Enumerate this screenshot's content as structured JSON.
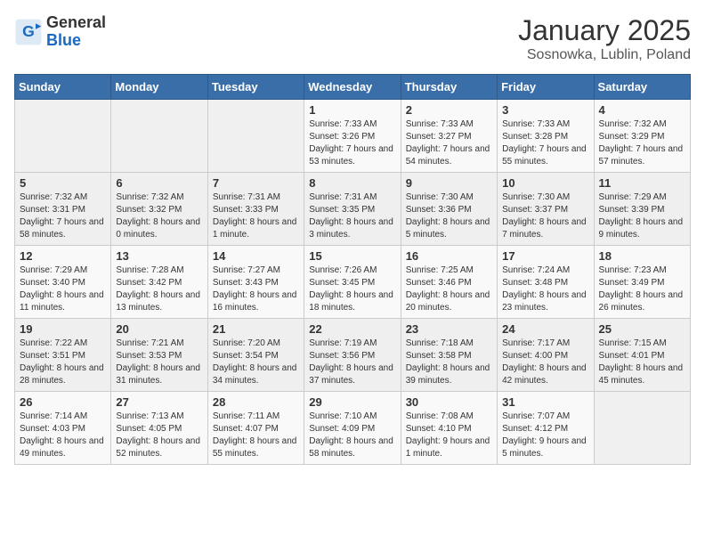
{
  "header": {
    "logo_general": "General",
    "logo_blue": "Blue",
    "title": "January 2025",
    "subtitle": "Sosnowka, Lublin, Poland"
  },
  "calendar": {
    "days_of_week": [
      "Sunday",
      "Monday",
      "Tuesday",
      "Wednesday",
      "Thursday",
      "Friday",
      "Saturday"
    ],
    "weeks": [
      [
        {
          "day": "",
          "info": ""
        },
        {
          "day": "",
          "info": ""
        },
        {
          "day": "",
          "info": ""
        },
        {
          "day": "1",
          "info": "Sunrise: 7:33 AM\nSunset: 3:26 PM\nDaylight: 7 hours and 53 minutes."
        },
        {
          "day": "2",
          "info": "Sunrise: 7:33 AM\nSunset: 3:27 PM\nDaylight: 7 hours and 54 minutes."
        },
        {
          "day": "3",
          "info": "Sunrise: 7:33 AM\nSunset: 3:28 PM\nDaylight: 7 hours and 55 minutes."
        },
        {
          "day": "4",
          "info": "Sunrise: 7:32 AM\nSunset: 3:29 PM\nDaylight: 7 hours and 57 minutes."
        }
      ],
      [
        {
          "day": "5",
          "info": "Sunrise: 7:32 AM\nSunset: 3:31 PM\nDaylight: 7 hours and 58 minutes."
        },
        {
          "day": "6",
          "info": "Sunrise: 7:32 AM\nSunset: 3:32 PM\nDaylight: 8 hours and 0 minutes."
        },
        {
          "day": "7",
          "info": "Sunrise: 7:31 AM\nSunset: 3:33 PM\nDaylight: 8 hours and 1 minute."
        },
        {
          "day": "8",
          "info": "Sunrise: 7:31 AM\nSunset: 3:35 PM\nDaylight: 8 hours and 3 minutes."
        },
        {
          "day": "9",
          "info": "Sunrise: 7:30 AM\nSunset: 3:36 PM\nDaylight: 8 hours and 5 minutes."
        },
        {
          "day": "10",
          "info": "Sunrise: 7:30 AM\nSunset: 3:37 PM\nDaylight: 8 hours and 7 minutes."
        },
        {
          "day": "11",
          "info": "Sunrise: 7:29 AM\nSunset: 3:39 PM\nDaylight: 8 hours and 9 minutes."
        }
      ],
      [
        {
          "day": "12",
          "info": "Sunrise: 7:29 AM\nSunset: 3:40 PM\nDaylight: 8 hours and 11 minutes."
        },
        {
          "day": "13",
          "info": "Sunrise: 7:28 AM\nSunset: 3:42 PM\nDaylight: 8 hours and 13 minutes."
        },
        {
          "day": "14",
          "info": "Sunrise: 7:27 AM\nSunset: 3:43 PM\nDaylight: 8 hours and 16 minutes."
        },
        {
          "day": "15",
          "info": "Sunrise: 7:26 AM\nSunset: 3:45 PM\nDaylight: 8 hours and 18 minutes."
        },
        {
          "day": "16",
          "info": "Sunrise: 7:25 AM\nSunset: 3:46 PM\nDaylight: 8 hours and 20 minutes."
        },
        {
          "day": "17",
          "info": "Sunrise: 7:24 AM\nSunset: 3:48 PM\nDaylight: 8 hours and 23 minutes."
        },
        {
          "day": "18",
          "info": "Sunrise: 7:23 AM\nSunset: 3:49 PM\nDaylight: 8 hours and 26 minutes."
        }
      ],
      [
        {
          "day": "19",
          "info": "Sunrise: 7:22 AM\nSunset: 3:51 PM\nDaylight: 8 hours and 28 minutes."
        },
        {
          "day": "20",
          "info": "Sunrise: 7:21 AM\nSunset: 3:53 PM\nDaylight: 8 hours and 31 minutes."
        },
        {
          "day": "21",
          "info": "Sunrise: 7:20 AM\nSunset: 3:54 PM\nDaylight: 8 hours and 34 minutes."
        },
        {
          "day": "22",
          "info": "Sunrise: 7:19 AM\nSunset: 3:56 PM\nDaylight: 8 hours and 37 minutes."
        },
        {
          "day": "23",
          "info": "Sunrise: 7:18 AM\nSunset: 3:58 PM\nDaylight: 8 hours and 39 minutes."
        },
        {
          "day": "24",
          "info": "Sunrise: 7:17 AM\nSunset: 4:00 PM\nDaylight: 8 hours and 42 minutes."
        },
        {
          "day": "25",
          "info": "Sunrise: 7:15 AM\nSunset: 4:01 PM\nDaylight: 8 hours and 45 minutes."
        }
      ],
      [
        {
          "day": "26",
          "info": "Sunrise: 7:14 AM\nSunset: 4:03 PM\nDaylight: 8 hours and 49 minutes."
        },
        {
          "day": "27",
          "info": "Sunrise: 7:13 AM\nSunset: 4:05 PM\nDaylight: 8 hours and 52 minutes."
        },
        {
          "day": "28",
          "info": "Sunrise: 7:11 AM\nSunset: 4:07 PM\nDaylight: 8 hours and 55 minutes."
        },
        {
          "day": "29",
          "info": "Sunrise: 7:10 AM\nSunset: 4:09 PM\nDaylight: 8 hours and 58 minutes."
        },
        {
          "day": "30",
          "info": "Sunrise: 7:08 AM\nSunset: 4:10 PM\nDaylight: 9 hours and 1 minute."
        },
        {
          "day": "31",
          "info": "Sunrise: 7:07 AM\nSunset: 4:12 PM\nDaylight: 9 hours and 5 minutes."
        },
        {
          "day": "",
          "info": ""
        }
      ]
    ]
  }
}
